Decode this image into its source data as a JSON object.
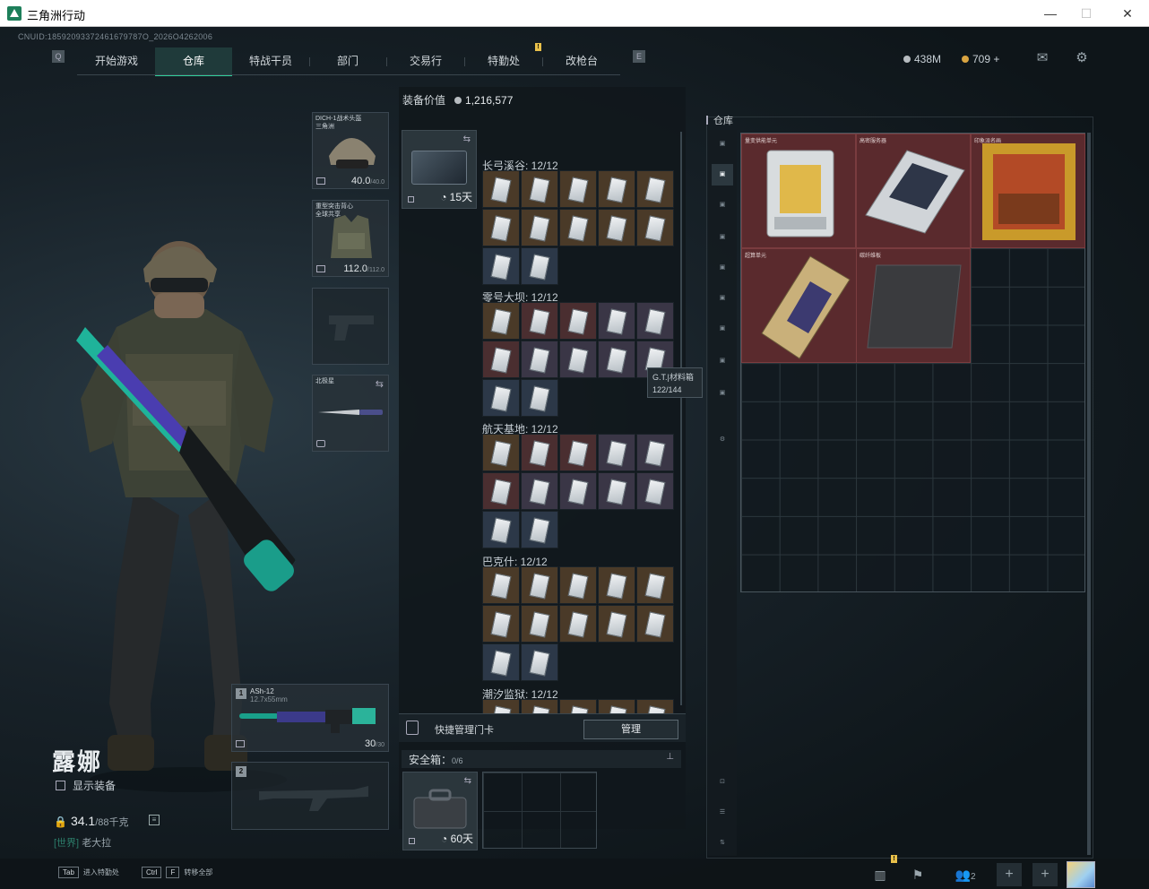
{
  "window": {
    "title": "三角洲行动",
    "minimize": "—",
    "maximize": "☐",
    "close": "✕"
  },
  "uid": "CNUID:18592093372461679787O_2026O4262006",
  "nav": {
    "left_key": "Q",
    "right_key": "E",
    "tabs": [
      {
        "label": "开始游戏"
      },
      {
        "label": "仓库",
        "active": true
      },
      {
        "label": "特战干员"
      },
      {
        "label": "部门"
      },
      {
        "label": "交易行"
      },
      {
        "label": "特勤处",
        "badge": "!"
      },
      {
        "label": "改枪台"
      }
    ]
  },
  "currency": {
    "silver": "438M",
    "gold": "709 +",
    "silver_color": "#b7bcc0",
    "gold_color": "#d9a441"
  },
  "character": {
    "name": "露娜",
    "show_equipment": "显示装备",
    "weight": "34.1",
    "weight_max": "/88千克",
    "chat_channel": "[世界]",
    "chat_user": "老大拉"
  },
  "equipment": {
    "helmet": {
      "label": "DICH-1战术头盔",
      "sub": "三角洲",
      "durability": "40.0",
      "max": "/40.0"
    },
    "armor": {
      "label": "重型突击背心",
      "sub": "全球共享",
      "durability": "112.0",
      "max": "/112.0"
    },
    "melee": {
      "label": "北极星"
    },
    "weapon1": {
      "slot": "1",
      "name": "ASh-12",
      "ammo_type": "12.7x55mm",
      "ammo": "30",
      "ammo_max": "/30"
    },
    "weapon2": {
      "slot": "2"
    }
  },
  "keycards": {
    "value_label": "装备价值",
    "value": "1,216,577",
    "bag_days": "15天",
    "regions": [
      {
        "name": "长弓溪谷",
        "count": "12/12",
        "color": "brown"
      },
      {
        "name": "零号大坝",
        "count": "12/12",
        "color": "mixed"
      },
      {
        "name": "航天基地",
        "count": "12/12",
        "color": "mixed"
      },
      {
        "name": "巴克什",
        "count": "12/12",
        "color": "brown"
      },
      {
        "name": "潮汐监狱",
        "count": "12/12",
        "color": "brown"
      }
    ],
    "tooltip_name": "G.T.|材料箱",
    "tooltip_count": "122/144",
    "quick_label": "快捷管理门卡",
    "manage_label": "管理"
  },
  "safebox": {
    "label": "安全箱",
    "count": "0/6",
    "days": "60天"
  },
  "warehouse": {
    "title": "仓库",
    "items": [
      {
        "name": "量变供能单元",
        "color": "#5a2a2d"
      },
      {
        "name": "高密服务器",
        "color": "#5a2a2d"
      },
      {
        "name": "印象派名画",
        "color": "#5a2a2d"
      },
      {
        "name": "超算单元",
        "color": "#5a2a2d"
      },
      {
        "name": "碳纤维板",
        "color": "#5a2a2d"
      }
    ],
    "sidebar_tabs": [
      "",
      "",
      "",
      "",
      "",
      "",
      "",
      "",
      "",
      "",
      ""
    ]
  },
  "bottom": {
    "tab_key": "Tab",
    "tab_label": "进入特勤处",
    "ctrl_key": "Ctrl",
    "f_key": "F",
    "ctrl_label": "转移全部",
    "friends_count": "2"
  }
}
